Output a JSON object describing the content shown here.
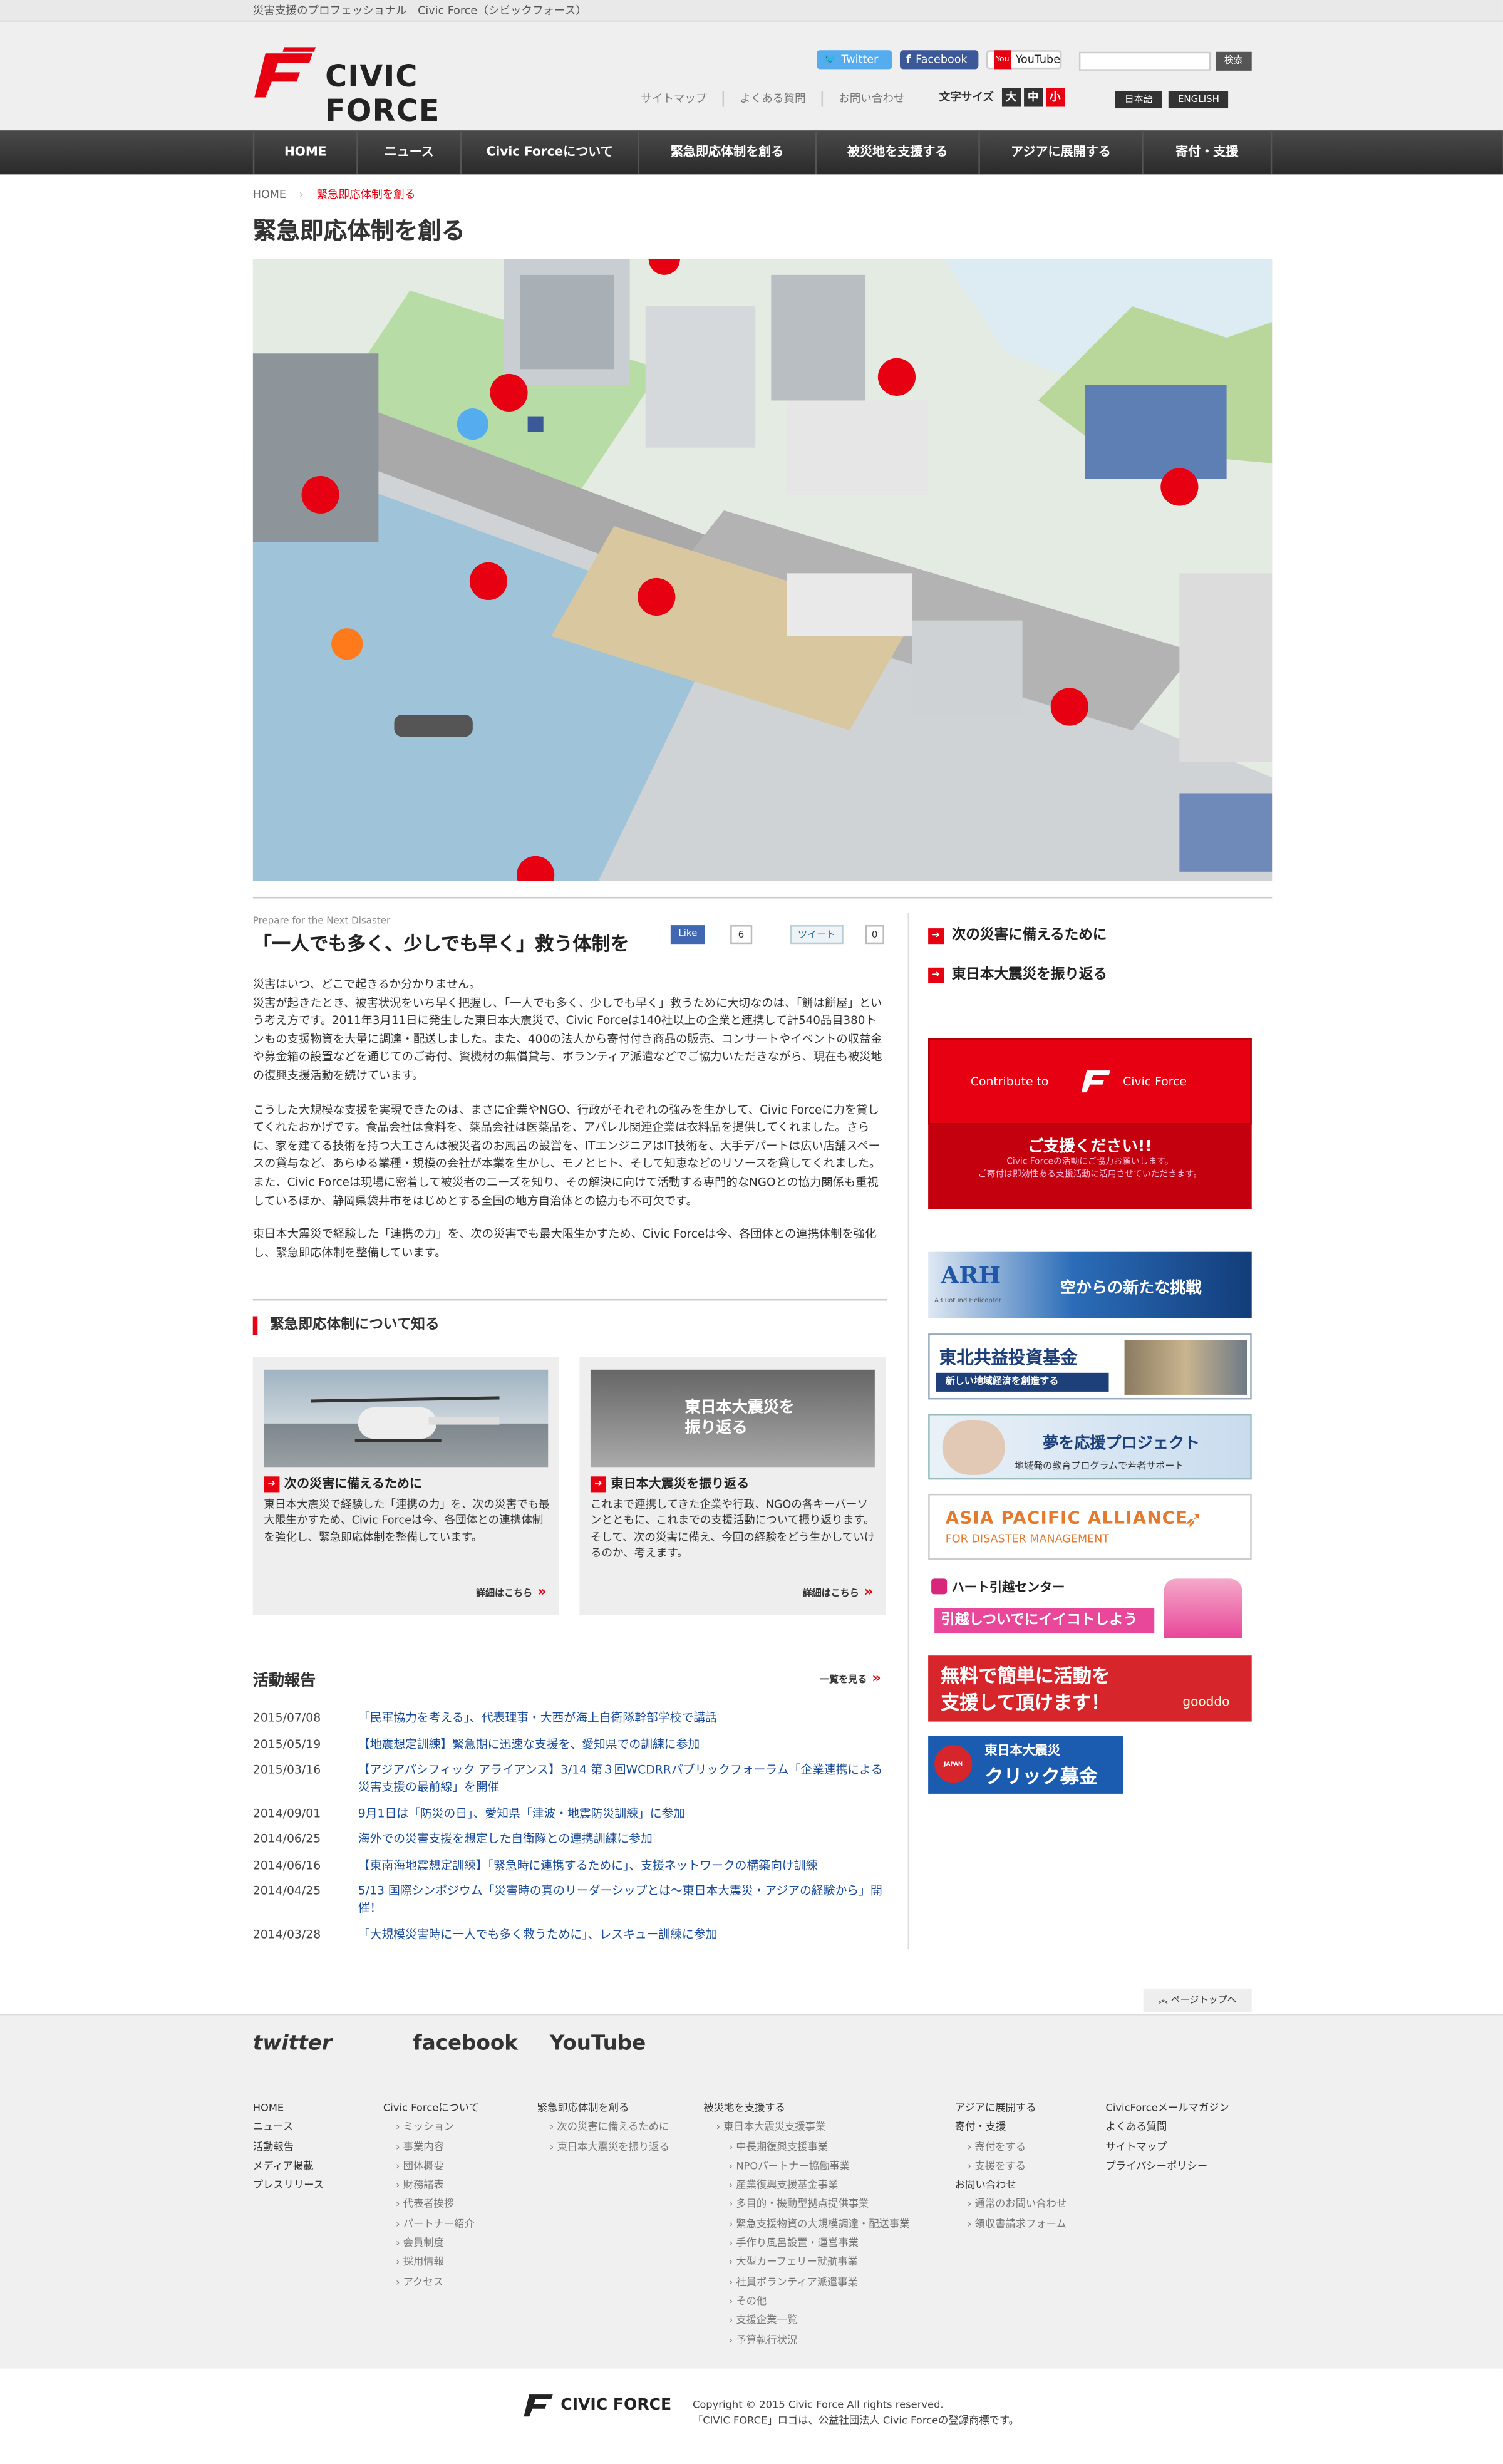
{
  "topbar": {
    "tagline": "災害支援のプロフェッショナル　Civic Force（シビックフォース）"
  },
  "header": {
    "logo_text": "CIVIC FORCE",
    "social": {
      "twitter": "Twitter",
      "facebook": "Facebook",
      "youtube": "YouTube"
    },
    "search_button": "検索",
    "links": [
      "サイトマップ",
      "よくある質問",
      "お問い合わせ"
    ],
    "font_size_label": "文字サイズ",
    "font_sizes": [
      "大",
      "中",
      "小"
    ],
    "languages": [
      "日本語",
      "ENGLISH"
    ]
  },
  "nav": [
    "HOME",
    "ニュース",
    "Civic Forceについて",
    "緊急即応体制を創る",
    "被災地を支援する",
    "アジアに展開する",
    "寄付・支援"
  ],
  "breadcrumb": {
    "home": "HOME",
    "sep": "›",
    "current": "緊急即応体制を創る"
  },
  "page_title": "緊急即応体制を創る",
  "intro": {
    "en_label": "Prepare for the Next Disaster",
    "heading": "「一人でも多く、少しでも早く」救う体制を",
    "like_label": "Like",
    "like_count": "6",
    "tweet_label": "ツイート",
    "tweet_count": "0",
    "paragraphs": [
      "災害はいつ、どこで起きるか分かりません。\n災害が起きたとき、被害状況をいち早く把握し、「一人でも多く、少しでも早く」救うために大切なのは、「餅は餅屋」という考え方です。2011年3月11日に発生した東日本大震災で、Civic Forceは140社以上の企業と連携して計540品目380トンもの支援物資を大量に調達・配送しました。また、400の法人から寄付付き商品の販売、コンサートやイベントの収益金や募金箱の設置などを通じてのご寄付、資機材の無償貸与、ボランティア派遣などでご協力いただきながら、現在も被災地の復興支援活動を続けています。",
      "こうした大規模な支援を実現できたのは、まさに企業やNGO、行政がそれぞれの強みを生かして、Civic Forceに力を貸してくれたおかげです。食品会社は食料を、薬品会社は医薬品を、アパレル関連企業は衣料品を提供してくれました。さらに、家を建てる技術を持つ大工さんは被災者のお風呂の設営を、ITエンジニアはIT技術を、大手デパートは広い店舗スペースの貸与など、あらゆる業種・規模の会社が本業を生かし、モノとヒト、そして知恵などのリソースを貸してくれました。\nまた、Civic Forceは現場に密着して被災者のニーズを知り、その解決に向けて活動する専門的なNGOとの協力関係も重視しているほか、静岡県袋井市をはじめとする全国の地方自治体との協力も不可欠です。",
      "東日本大震災で経験した「連携の力」を、次の災害でも最大限生かすため、Civic Forceは今、各団体との連携体制を強化し、緊急即応体制を整備しています。"
    ]
  },
  "know_section": {
    "title": "緊急即応体制について知る",
    "cards": [
      {
        "title": "次の災害に備えるために",
        "desc": "東日本大震災で経験した「連携の力」を、次の災害でも最大限生かすため、Civic Forceは今、各団体との連携体制を強化し、緊急即応体制を整備しています。",
        "more": "詳細はこちら"
      },
      {
        "title": "東日本大震災を振り返る",
        "desc": "これまで連携してきた企業や行政、NGOの各キーパーソンとともに、これまでの支援活動について振り返ります。そして、次の災害に備え、今回の経験をどう生かしていけるのか、考えます。",
        "more": "詳細はこちら",
        "photo_caption": "東日本大震災を振り返る"
      }
    ]
  },
  "activity": {
    "title": "活動報告",
    "more": "一覧を見る",
    "items": [
      {
        "date": "2015/07/08",
        "text": "「民軍協力を考える」、代表理事・大西が海上自衛隊幹部学校で講話"
      },
      {
        "date": "2015/05/19",
        "text": "【地震想定訓練】緊急期に迅速な支援を、愛知県での訓練に参加"
      },
      {
        "date": "2015/03/16",
        "text": "【アジアパシフィック アライアンス】3/14 第３回WCDRRパブリックフォーラム「企業連携による災害支援の最前線」を開催"
      },
      {
        "date": "2014/09/01",
        "text": "9月1日は「防災の日」、愛知県「津波・地震防災訓練」に参加"
      },
      {
        "date": "2014/06/25",
        "text": "海外での災害支援を想定した自衛隊との連携訓練に参加"
      },
      {
        "date": "2014/06/16",
        "text": "【東南海地震想定訓練】「緊急時に連携するために」、支援ネットワークの構築向け訓練"
      },
      {
        "date": "2014/04/25",
        "text": "5/13 国際シンポジウム「災害時の真のリーダーシップとは〜東日本大震災・アジアの経験から」開催！"
      },
      {
        "date": "2014/03/28",
        "text": "「大規模災害時に一人でも多く救うために」、レスキュー訓練に参加"
      }
    ]
  },
  "sidebar": {
    "links": [
      "次の災害に備えるために",
      "東日本大震災を振り返る"
    ],
    "contribute": {
      "pre": "Contribute to",
      "post": "Civic Force",
      "big": "ご支援ください!!",
      "small1": "Civic Forceの活動にご協力お願いします。",
      "small2": "ご寄付は即効性ある支援活動に活用させていただきます。"
    },
    "banners": {
      "arh": {
        "logo": "ARH",
        "sub": "A3 Rotund Helicopter",
        "text": "空からの新たな挑戦"
      },
      "tohoku": {
        "title": "東北共益投資基金",
        "sub": "新しい地域経済を創造する"
      },
      "dream": {
        "title": "夢を応援プロジェクト",
        "sub": "地域発の教育プログラムで若者サポート"
      },
      "apad": {
        "line1": "ASIA PACIFIC ALLIANCE",
        "line2": "FOR DISASTER MANAGEMENT"
      },
      "heart": {
        "title": "ハート引越センター",
        "sub": "引越しついでにイイコトしよう"
      },
      "gooddo": {
        "line1": "無料で簡単に活動を",
        "line2": "支援して頂けます！",
        "brand": "gooddo"
      },
      "click": {
        "badge": "JAPAN GIVING",
        "line1": "東日本大震災",
        "line2": "クリック募金"
      }
    }
  },
  "page_top": "ページトップへ",
  "footer": {
    "social": [
      "twitter",
      "facebook",
      "YouTube"
    ],
    "col1": [
      "HOME",
      "ニュース",
      "活動報告",
      "メディア掲載",
      "プレスリリース"
    ],
    "col2": {
      "head": "Civic Forceについて",
      "items": [
        "ミッション",
        "事業内容",
        "団体概要",
        "財務諸表",
        "代表者挨拶",
        "パートナー紹介",
        "会員制度",
        "採用情報",
        "アクセス"
      ]
    },
    "col3": {
      "head": "緊急即応体制を創る",
      "items": [
        "次の災害に備えるために",
        "東日本大震災を振り返る"
      ]
    },
    "col4": {
      "head": "被災地を支援する",
      "items": [
        "東日本大震災支援事業"
      ],
      "sub": [
        "中長期復興支援事業",
        "NPOパートナー協働事業",
        "産業復興支援基金事業",
        "多目的・機動型拠点提供事業",
        "緊急支援物資の大規模調達・配送事業",
        "手作り風呂設置・運営事業",
        "大型カーフェリー就航事業",
        "社員ボランティア派遣事業",
        "その他",
        "支援企業一覧",
        "予算執行状況"
      ]
    },
    "col5": {
      "head1": "アジアに展開する",
      "head2": "寄付・支援",
      "items2": [
        "寄付をする",
        "支援をする"
      ],
      "head3": "お問い合わせ",
      "items3": [
        "通常のお問い合わせ",
        "領収書請求フォーム"
      ]
    },
    "col6": [
      "CivicForceメールマガジン",
      "よくある質問",
      "サイトマップ",
      "プライバシーポリシー"
    ],
    "logo_text": "CIVIC FORCE",
    "copyright": "Copyright © 2015 Civic Force All rights reserved.",
    "trademark": "「CIVIC FORCE」ロゴは、公益社団法人 Civic Forceの登録商標です。"
  },
  "colors": {
    "brand_red": "#e60012",
    "nav_dark": "#333333",
    "link_blue": "#1a4b9a"
  }
}
